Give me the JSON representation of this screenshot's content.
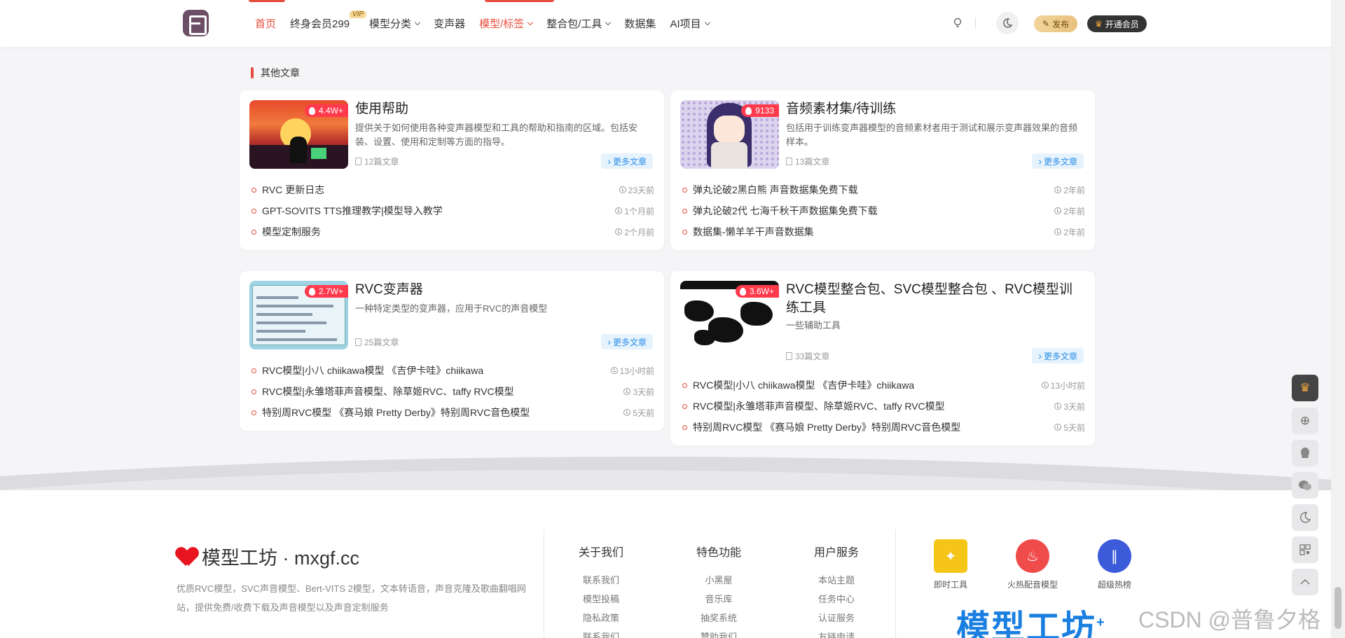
{
  "nav": {
    "items": [
      {
        "label": "首页"
      },
      {
        "label": "终身会员299",
        "badge": "VIP"
      },
      {
        "label": "模型分类"
      },
      {
        "label": "变声器"
      },
      {
        "label": "模型/标签"
      },
      {
        "label": "整合包/工具"
      },
      {
        "label": "数据集"
      },
      {
        "label": "AI项目"
      }
    ],
    "publish": "发布",
    "open_vip": "开通会员"
  },
  "section_title": "其他文章",
  "cards": [
    {
      "title": "使用帮助",
      "heat": "4.4W+",
      "desc": "提供关于如何使用各种变声器模型和工具的帮助和指南的区域。包括安装、设置、使用和定制等方面的指导。",
      "count": "12篇文章",
      "more": "更多文章",
      "posts": [
        {
          "title": "RVC 更新日志",
          "time": "23天前"
        },
        {
          "title": "GPT-SOVITS TTS推理教学|模型导入教学",
          "time": "1个月前"
        },
        {
          "title": "模型定制服务",
          "time": "2个月前"
        }
      ]
    },
    {
      "title": "音频素材集/待训练",
      "heat": "9133",
      "desc": "包括用于训练变声器模型的音频素材者用于测试和展示变声器效果的音频样本。",
      "count": "13篇文章",
      "more": "更多文章",
      "posts": [
        {
          "title": "弹丸论破2黑白熊 声音数据集免费下载",
          "time": "2年前"
        },
        {
          "title": "弹丸论破2代 七海千秋干声数据集免费下载",
          "time": "2年前"
        },
        {
          "title": "数据集-懒羊羊干声音数据集",
          "time": "2年前"
        }
      ]
    },
    {
      "title": "RVC变声器",
      "heat": "2.7W+",
      "desc": "一种特定类型的变声器，应用于RVC的声音模型",
      "count": "25篇文章",
      "more": "更多文章",
      "posts": [
        {
          "title": "RVC模型|小八 chiikawa模型 《吉伊卡哇》chiikawa",
          "time": "13小时前"
        },
        {
          "title": "RVC模型|永雏塔菲声音模型、除草姬RVC、taffy RVC模型",
          "time": "3天前"
        },
        {
          "title": "特别周RVC模型 《赛马娘 Pretty Derby》特别周RVC音色模型",
          "time": "5天前"
        }
      ]
    },
    {
      "title": "RVC模型整合包、SVC模型整合包 、RVC模型训练工具",
      "heat": "3.6W+",
      "desc": "一些辅助工具",
      "count": "33篇文章",
      "more": "更多文章",
      "posts": [
        {
          "title": "RVC模型|小八 chiikawa模型 《吉伊卡哇》chiikawa",
          "time": "13小时前"
        },
        {
          "title": "RVC模型|永雏塔菲声音模型、除草姬RVC、taffy RVC模型",
          "time": "3天前"
        },
        {
          "title": "特别周RVC模型 《赛马娘 Pretty Derby》特别周RVC音色模型",
          "time": "5天前"
        }
      ]
    }
  ],
  "footer": {
    "brand": "模型工坊 · mxgf.cc",
    "desc": "优质RVC模型，SVC声音模型、Bert-VITS 2模型，文本转语音，声音克隆及歌曲翻唱网站，提供免费/收费下载及声音模型以及声音定制服务",
    "cols": [
      {
        "title": "关于我们",
        "links": [
          "联系我们",
          "模型投稿",
          "隐私政策",
          "联系我们"
        ]
      },
      {
        "title": "特色功能",
        "links": [
          "小黑屋",
          "音乐库",
          "抽奖系统",
          "赞助我们"
        ]
      },
      {
        "title": "用户服务",
        "links": [
          "本站主题",
          "任务中心",
          "认证服务",
          "友链申请"
        ]
      }
    ],
    "apps": [
      {
        "label": "即时工具",
        "icon": "magic-wand-icon",
        "color": "#f5c518"
      },
      {
        "label": "火热配音模型",
        "icon": "fire-icon",
        "color": "#ef4b4b"
      },
      {
        "label": "超级热榜",
        "icon": "hot-list-icon",
        "color": "#3b5bdb"
      }
    ],
    "big_logo": "模型工坊",
    "big_logo_sup": "+",
    "watermark": "CSDN @普鲁夕格"
  },
  "colors": {
    "accent": "#e74c3c",
    "heat": "#ff3a4d",
    "link": "#2b8ee6"
  }
}
